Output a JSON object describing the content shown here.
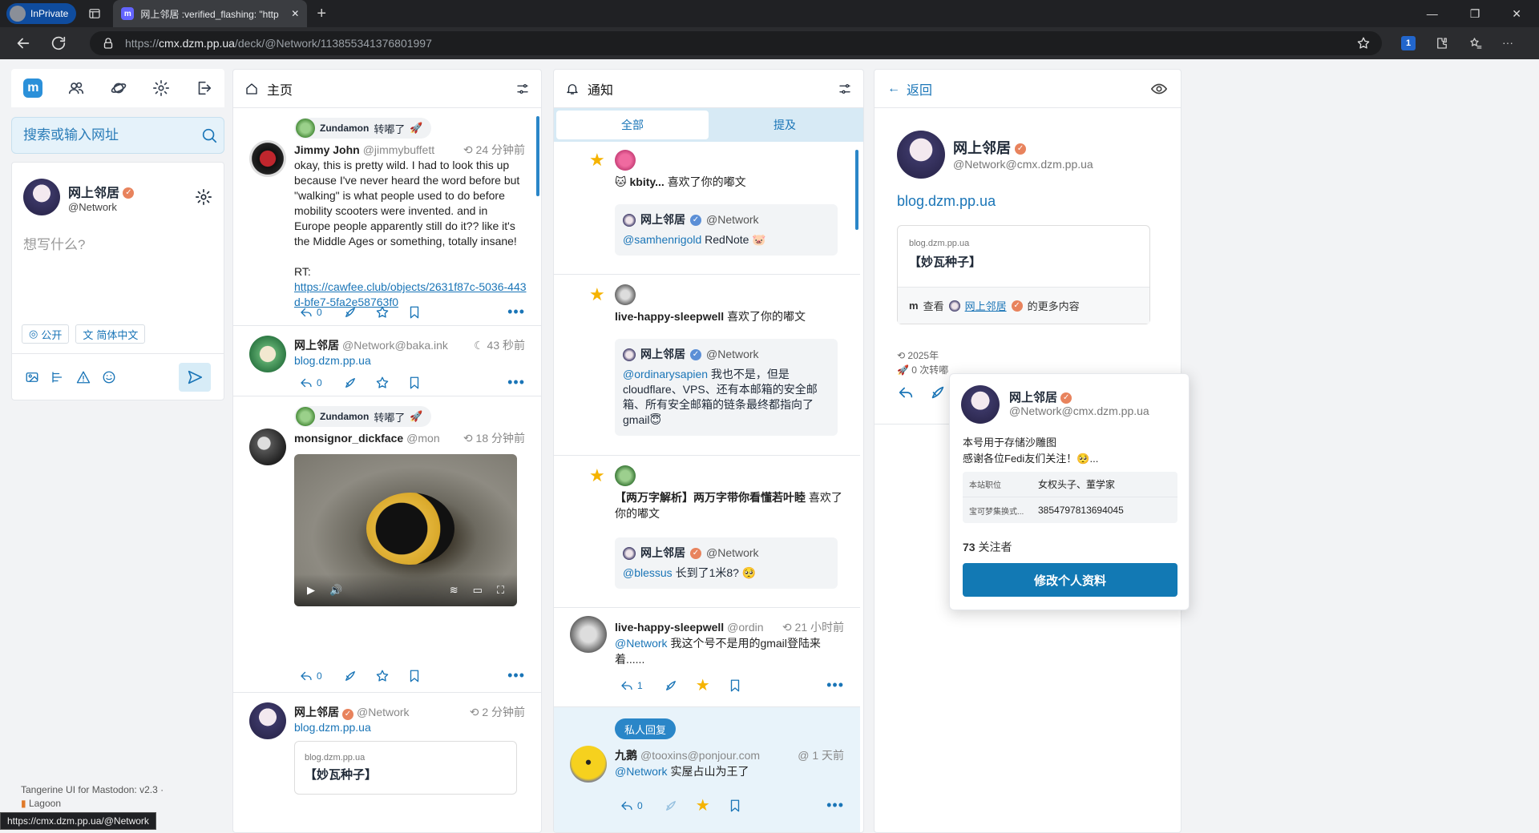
{
  "browser": {
    "inprivate_label": "InPrivate",
    "tab_title": "网上邻居 :verified_flashing: \"http",
    "url_prefix": "https://",
    "url_host": "cmx.dzm.pp.ua",
    "url_path": "/deck/@Network/113855341376801997",
    "status_url": "https://cmx.dzm.pp.ua/@Network"
  },
  "left": {
    "search_placeholder": "搜索或输入网址",
    "me_name": "网上邻居",
    "me_handle": "@Network",
    "compose_placeholder": "想写什么?",
    "visibility": "公开",
    "language": "简体中文",
    "footer_line1": "Tangerine UI for Mastodon: v2.3 ·",
    "footer_line2": "Lagoon"
  },
  "home": {
    "title": "主页",
    "posts": [
      {
        "boosted_by": "Zundamon",
        "boost_label": "转嘟了",
        "name": "Jimmy John",
        "handle": "@jimmybuffett",
        "time": "24 分钟前",
        "text": "okay, this is pretty wild. I had to look this up because I've never heard the word before but \"walking\" is what people used to do before mobility scooters were invented. and in Europe people apparently still do it?? like it's the Middle Ages or something, totally insane!",
        "rt": "RT:",
        "link": "https://cawfee.club/objects/2631f87c-5036-443d-bfe7-5fa2e58763f0",
        "replies": "0"
      },
      {
        "name": "网上邻居",
        "handle": "@Network@baka.ink",
        "time": "43 秒前",
        "link": "blog.dzm.pp.ua",
        "replies": "0"
      },
      {
        "boosted_by": "Zundamon",
        "boost_label": "转嘟了",
        "name": "monsignor_dickface",
        "handle": "@mon",
        "time": "18 分钟前",
        "replies": "0"
      },
      {
        "name": "网上邻居",
        "handle": "@Network",
        "time": "2 分钟前",
        "link": "blog.dzm.pp.ua",
        "card_domain": "blog.dzm.pp.ua",
        "card_title": "【妙瓦种子】"
      }
    ]
  },
  "notifications": {
    "title": "通知",
    "tab_all": "全部",
    "tab_mentions": "提及",
    "items": [
      {
        "actor": "kbity...",
        "action": "喜欢了你的嘟文",
        "q_name": "网上邻居",
        "q_handle": "@Network",
        "q_mention": "@samhenrigold",
        "q_text": " RedNote 🐷"
      },
      {
        "actor": "live-happy-sleepwell",
        "action": "喜欢了你的嘟文",
        "q_name": "网上邻居",
        "q_handle": "@Network",
        "q_mention": "@ordinarysapien",
        "q_text": " 我也不是，但是cloudflare、VPS、还有本邮箱的安全邮箱、所有安全邮箱的链条最终都指向了gmail😇"
      },
      {
        "actor": "【两万字解析】两万字带你看懂若叶睦",
        "action": "喜欢了你的嘟文",
        "q_name": "网上邻居",
        "q_handle": "@Network",
        "q_mention": "@blessus",
        "q_text": " 长到了1米8? 🥺"
      },
      {
        "name": "live-happy-sleepwell",
        "handle": "@ordin",
        "time": "21 小时前",
        "mention": "@Network",
        "text": " 我这个号不是用的gmail登陆来着......",
        "replies": "1"
      },
      {
        "dm_label": "私人回复",
        "name": "九鹅",
        "handle": "@tooxins@ponjour.com",
        "time": "1 天前",
        "mention": "@Network",
        "text": " 实屋占山为王了",
        "replies": "0"
      }
    ]
  },
  "profile": {
    "back_label": "返回",
    "name": "网上邻居",
    "handle": "@Network@cmx.dzm.pp.ua",
    "link": "blog.dzm.pp.ua",
    "card_domain": "blog.dzm.pp.ua",
    "card_title": "【妙瓦种子】",
    "more_prefix": "查看",
    "more_name": "网上邻居",
    "more_suffix": "的更多内容",
    "meta_date": "2025年",
    "meta_boosts": "0 次转嘟"
  },
  "popup": {
    "name": "网上邻居",
    "handle": "@Network@cmx.dzm.pp.ua",
    "bio_line1": "本号用于存储沙雕图",
    "bio_line2": "感谢各位Fedi友们关注！🥺...",
    "fields": [
      {
        "key": "本站职位",
        "value": "女权头子、董学家"
      },
      {
        "key": "宝可梦集换式...",
        "value": "3854797813694045"
      }
    ],
    "followers_count": "73",
    "followers_label": "关注者",
    "edit_button": "修改个人资料"
  }
}
